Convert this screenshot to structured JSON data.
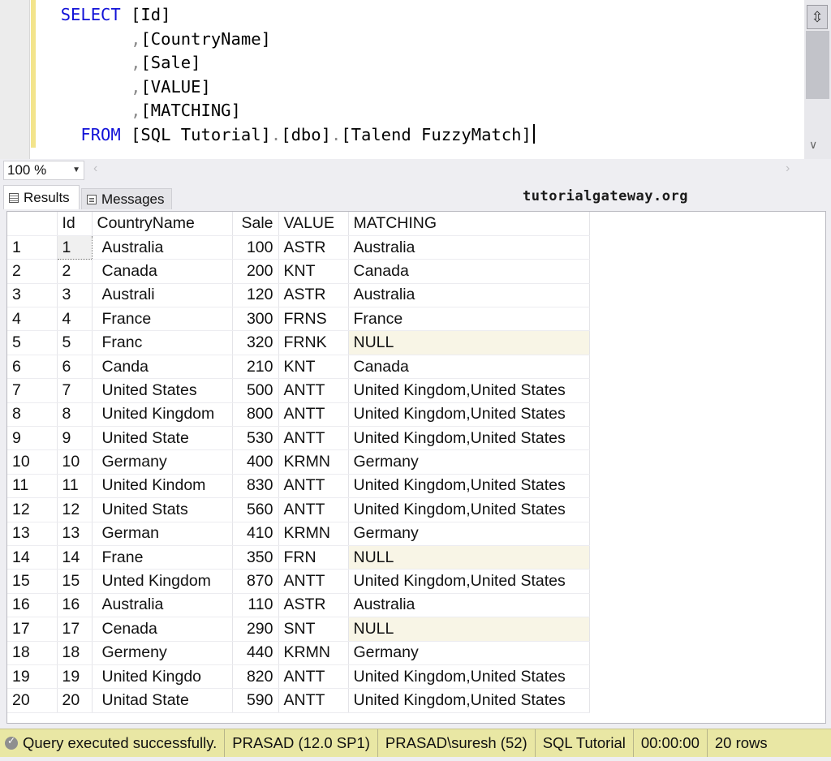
{
  "editor": {
    "lines": [
      {
        "kw": "SELECT",
        "text": " [Id]"
      },
      {
        "indent": "       ",
        "sep": ",",
        "text": "[CountryName]"
      },
      {
        "indent": "       ",
        "sep": ",",
        "text": "[Sale]"
      },
      {
        "indent": "       ",
        "sep": ",",
        "text": "[VALUE]"
      },
      {
        "indent": "       ",
        "sep": ",",
        "text": "[MATCHING]"
      }
    ],
    "from_kw": "FROM",
    "from_parts": [
      "[SQL Tutorial]",
      ".",
      "[dbo]",
      ".",
      "[Talend FuzzyMatch]"
    ]
  },
  "zoom": {
    "value": "100 %"
  },
  "tabs": {
    "results": "Results",
    "messages": "Messages"
  },
  "watermark": "tutorialgateway.org",
  "grid": {
    "columns": [
      "Id",
      "CountryName",
      "Sale",
      "VALUE",
      "MATCHING"
    ],
    "rows": [
      [
        "1",
        "1",
        "Australia",
        "100",
        "ASTR",
        "Australia"
      ],
      [
        "2",
        "2",
        "Canada",
        "200",
        "KNT",
        "Canada"
      ],
      [
        "3",
        "3",
        "Australi",
        "120",
        "ASTR",
        "Australia"
      ],
      [
        "4",
        "4",
        "France",
        "300",
        "FRNS",
        "France"
      ],
      [
        "5",
        "5",
        "Franc",
        "320",
        "FRNK",
        "NULL"
      ],
      [
        "6",
        "6",
        "Canda",
        "210",
        "KNT",
        "Canada"
      ],
      [
        "7",
        "7",
        "United States",
        "500",
        "ANTT",
        "United Kingdom,United States"
      ],
      [
        "8",
        "8",
        "United Kingdom",
        "800",
        "ANTT",
        "United Kingdom,United States"
      ],
      [
        "9",
        "9",
        "United State",
        "530",
        "ANTT",
        "United Kingdom,United States"
      ],
      [
        "10",
        "10",
        "Germany",
        "400",
        "KRMN",
        "Germany"
      ],
      [
        "11",
        "11",
        "United Kindom",
        "830",
        "ANTT",
        "United Kingdom,United States"
      ],
      [
        "12",
        "12",
        "United Stats",
        "560",
        "ANTT",
        "United Kingdom,United States"
      ],
      [
        "13",
        "13",
        "German",
        "410",
        "KRMN",
        "Germany"
      ],
      [
        "14",
        "14",
        "Frane",
        "350",
        "FRN",
        "NULL"
      ],
      [
        "15",
        "15",
        "Unted Kingdom",
        "870",
        "ANTT",
        "United Kingdom,United States"
      ],
      [
        "16",
        "16",
        "Australia",
        "110",
        "ASTR",
        "Australia"
      ],
      [
        "17",
        "17",
        "Cenada",
        "290",
        "SNT",
        "NULL"
      ],
      [
        "18",
        "18",
        "Germeny",
        "440",
        "KRMN",
        "Germany"
      ],
      [
        "19",
        "19",
        "United Kingdo",
        "820",
        "ANTT",
        "United Kingdom,United States"
      ],
      [
        "20",
        "20",
        "Unitad State",
        "590",
        "ANTT",
        "United Kingdom,United States"
      ]
    ]
  },
  "status": {
    "message": "Query executed successfully.",
    "server": "PRASAD (12.0 SP1)",
    "user": "PRASAD\\suresh (52)",
    "database": "SQL Tutorial",
    "elapsed": "00:00:00",
    "rows": "20 rows"
  },
  "colors": {
    "keyword": "#1212d8",
    "status_bar": "#e9e7a4",
    "null_cell": "#f8f5e6"
  }
}
